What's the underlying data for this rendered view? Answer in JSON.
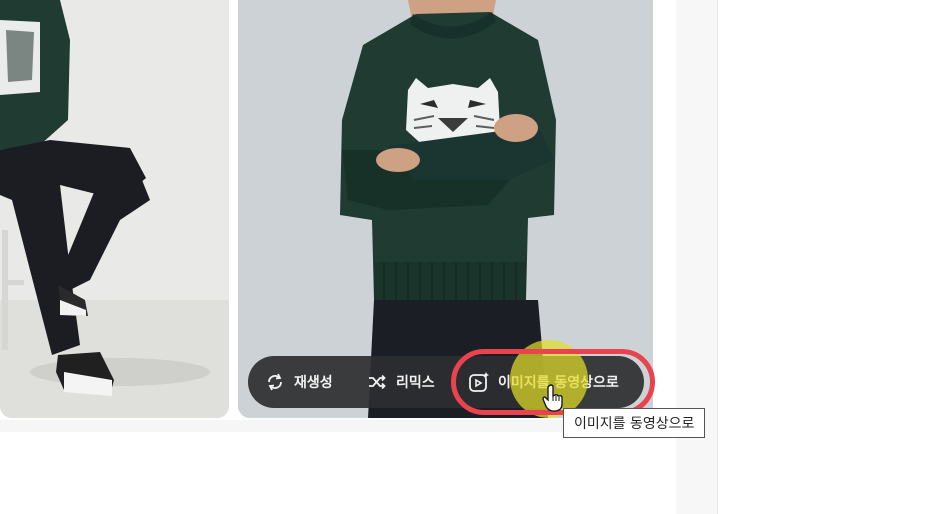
{
  "toolbar": {
    "regenerate_label": "재생성",
    "remix_label": "리믹스",
    "image_to_video_label": "이미지를 동영상으로"
  },
  "tooltip": {
    "text": "이미지를 동영상으로"
  },
  "colors": {
    "highlight_ring": "#e8434f",
    "cursor_highlight": "#e2dc28",
    "sweater_green": "#1f3b32",
    "toolbar_bg": "#2c2e30"
  },
  "icons": {
    "regenerate": "refresh-icon",
    "remix": "shuffle-icon",
    "image_to_video": "video-sparkle-icon"
  }
}
